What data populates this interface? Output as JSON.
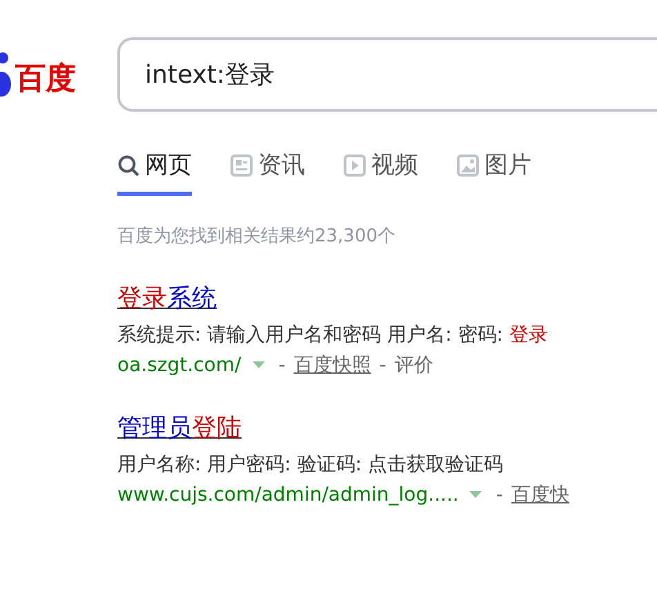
{
  "logo": {
    "text": "百度"
  },
  "search": {
    "value": "intext:登录"
  },
  "tabs": [
    {
      "label": "网页",
      "kind": "search",
      "selected": true
    },
    {
      "label": "资讯",
      "kind": "news",
      "selected": false
    },
    {
      "label": "视频",
      "kind": "video",
      "selected": false
    },
    {
      "label": "图片",
      "kind": "image",
      "selected": false
    }
  ],
  "result_count": "百度为您找到相关结果约23,300个",
  "results": [
    {
      "title": [
        {
          "text": "登录",
          "highlight": true
        },
        {
          "text": "系统",
          "highlight": false
        }
      ],
      "snippet": [
        {
          "text": "系统提示: 请输入用户名和密码 用户名: 密码: ",
          "highlight": false
        },
        {
          "text": "登录",
          "highlight": true
        }
      ],
      "url": "oa.szgt.com/",
      "meta": [
        {
          "kind": "separator",
          "text": "-"
        },
        {
          "kind": "cache",
          "text": "百度快照"
        },
        {
          "kind": "separator",
          "text": "-"
        },
        {
          "kind": "link",
          "text": "评价"
        }
      ]
    },
    {
      "title": [
        {
          "text": "管理员",
          "highlight": false
        },
        {
          "text": "登陆",
          "highlight": true
        }
      ],
      "snippet": [
        {
          "text": "用户名称: 用户密码: 验证码: 点击获取验证码",
          "highlight": false
        }
      ],
      "url": "www.cujs.com/admin/admin_log.....",
      "meta": [
        {
          "kind": "separator",
          "text": "-"
        },
        {
          "kind": "cache",
          "text": "百度快"
        }
      ]
    }
  ]
}
